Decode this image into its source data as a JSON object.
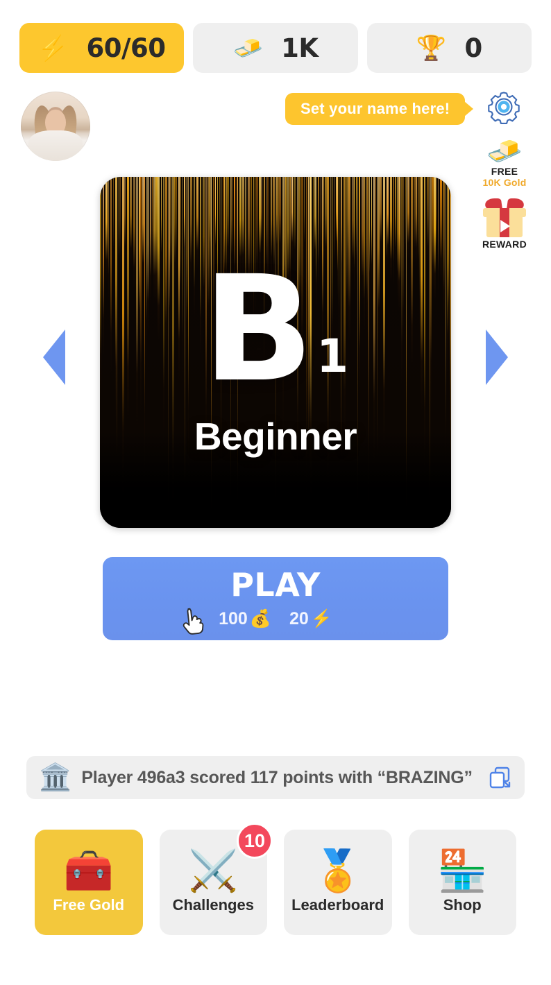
{
  "stats": [
    {
      "id": "energy",
      "icon": "lightning-bolt-icon",
      "glyph": "⚡",
      "value": "60/60"
    },
    {
      "id": "gold",
      "icon": "gold-bar-icon",
      "glyph": "🧈",
      "value": "1K"
    },
    {
      "id": "trophies",
      "icon": "trophy-icon",
      "glyph": "🏆",
      "value": "0"
    }
  ],
  "profile": {
    "avatar_alt": "player-avatar",
    "name_prompt": "Set your name here!",
    "settings_icon": "gear-icon"
  },
  "side_actions": [
    {
      "id": "free-gold",
      "icon": "gold-bars-icon",
      "glyph": "🧈",
      "line1": "FREE",
      "line2": "10K Gold"
    },
    {
      "id": "reward",
      "icon": "gift-video-icon",
      "line1": "REWARD",
      "line2": ""
    }
  ],
  "carousel": {
    "prev_icon": "arrow-left-icon",
    "next_icon": "arrow-right-icon",
    "card": {
      "letter": "B",
      "sublevel": "1",
      "name": "Beginner"
    }
  },
  "play": {
    "label": "PLAY",
    "cost_gold": "100",
    "cost_gold_icon": "💰",
    "cost_energy": "20",
    "cost_energy_icon": "⚡",
    "cursor_icon": "👆"
  },
  "ticker": {
    "left_icon": "laurel-bank-icon",
    "left_glyph": "🏛️",
    "message": "Player 496a3 scored 117 points with “BRAZING”",
    "share_icon": "copy-share-icon"
  },
  "bottom_nav": [
    {
      "id": "free-gold",
      "icon": "treasure-chest-icon",
      "glyph": "🧰",
      "label": "Free Gold",
      "active": true,
      "badge": ""
    },
    {
      "id": "challenges",
      "icon": "crossed-swords-icon",
      "glyph": "⚔️",
      "label": "Challenges",
      "active": false,
      "badge": "10"
    },
    {
      "id": "leaderboard",
      "icon": "medal-icon",
      "glyph": "🏅",
      "label": "Leaderboard",
      "active": false,
      "badge": ""
    },
    {
      "id": "shop",
      "icon": "storefront-icon",
      "glyph": "🏪",
      "label": "Shop",
      "active": false,
      "badge": ""
    }
  ],
  "colors": {
    "energy_pill": "#FDC72E",
    "neutral_pill": "#EFEFEF",
    "accent_blue": "#6E96F0",
    "tooltip_yellow": "#FDC52E",
    "badge_red": "#F3485C",
    "nav_active": "#F3C83C",
    "gold_text": "#F0A92A"
  }
}
